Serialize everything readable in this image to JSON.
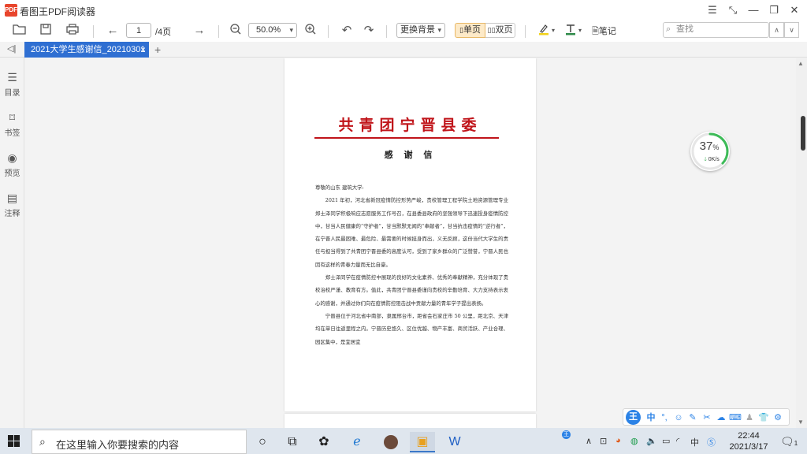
{
  "window": {
    "app_title": "看图王PDF阅读器",
    "logo_text": "PDF"
  },
  "toolbar": {
    "page_current": "1",
    "page_total": "/4页",
    "zoom": "50.0%",
    "bg_label": "更换背景",
    "single_label": "单页",
    "double_label": "双页",
    "note_label": "笔记",
    "search_placeholder": "查找"
  },
  "tab": {
    "title": "2021大学生感谢信_20210301"
  },
  "sidebar": {
    "items": [
      {
        "label": "目录",
        "icon": "list-icon"
      },
      {
        "label": "书签",
        "icon": "bookmark-icon"
      },
      {
        "label": "预览",
        "icon": "eye-icon"
      },
      {
        "label": "注释",
        "icon": "comment-icon"
      }
    ]
  },
  "document": {
    "org": "共青团宁晋县委",
    "heading": "感 谢 信",
    "salutation": "尊敬的山东  建筑大学:",
    "p1": "2021 年初，河北省新冠疫情防控形势严峻，贵校管理工程学院土地资源管理专业郑士泽同学积极响应志愿服务工作号召，在县委县政府的坚强领导下迅速投身疫情防控中，甘当人民健康的“守护者”，甘当默默无闻的“奉献者”，甘当抗击疫情的“逆行者”，在宁晋人民最困难、最危险、最需要的时候挺身而出，义无反顾，这份当代大学生的责任与担当得到了共青团宁晋县委的高度认可，受到了家乡群众的广泛赞誉，宁晋人民也因有这样的青春力量而无比自豪。",
    "p2": "郑士泽同学在疫情防控中展现的良好的文化素养、优秀的奉献精神，充分体现了贵校治校严谨、教育有方。值此，共青团宁晋县委谨向贵校的辛勤培育、大力支持表示衷心的感谢，并通过你们向在疫情防控阻击战中贡献力量的青年学子提出表扬。",
    "p3": "宁晋县位于河北省中南部，隶属邢台市，距省会石家庄市 50 公里，距北京、天津均在单日往返里程之内。宁晋历史悠久、区位优越、物产丰富、商贸活跃、产业合理、园区集中，是宜居宜"
  },
  "speed_widget": {
    "percent": "37",
    "percent_unit": "%",
    "rate": "0K/s"
  },
  "ime": {
    "logo": "王",
    "mode": "中"
  },
  "taskbar": {
    "search_text": "在这里输入你要搜索的内容",
    "ime_tray": "中",
    "time": "22:44",
    "date": "2021/3/17",
    "notif_count": "1"
  }
}
